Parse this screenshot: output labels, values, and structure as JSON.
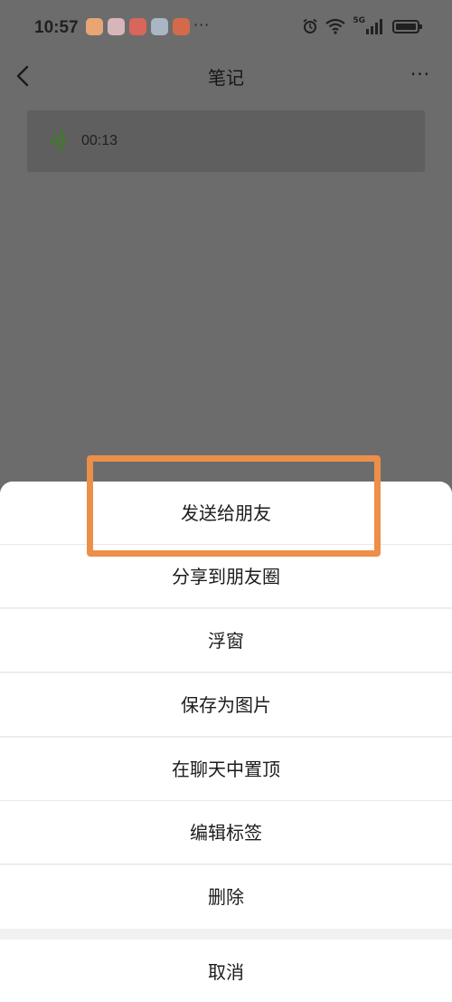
{
  "status_bar": {
    "time": "10:57",
    "network": "5G",
    "more_icons": "···"
  },
  "header": {
    "title": "笔记",
    "more": "···"
  },
  "voice_note": {
    "duration": "00:13"
  },
  "action_sheet": {
    "items": [
      {
        "label": "发送给朋友"
      },
      {
        "label": "分享到朋友圈"
      },
      {
        "label": "浮窗"
      },
      {
        "label": "保存为图片"
      },
      {
        "label": "在聊天中置顶"
      },
      {
        "label": "编辑标签"
      },
      {
        "label": "删除"
      }
    ],
    "cancel": "取消"
  },
  "colors": {
    "highlight": "#ec8f4a",
    "voice_icon": "#4a8f2e"
  }
}
